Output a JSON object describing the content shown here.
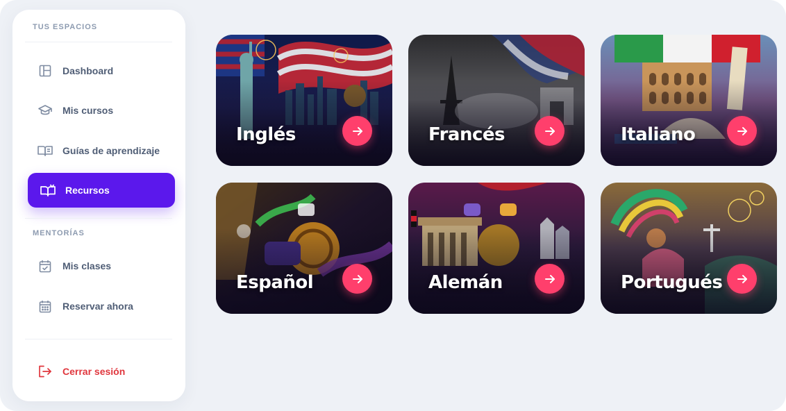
{
  "sidebar": {
    "section_spaces": "TUS ESPACIOS",
    "section_mentoring": "MENTORÍAS",
    "items": [
      {
        "label": "Dashboard",
        "icon": "layout-icon"
      },
      {
        "label": "Mis cursos",
        "icon": "graduation-cap-icon"
      },
      {
        "label": "Guías de aprendizaje",
        "icon": "open-book-icon"
      },
      {
        "label": "Recursos",
        "icon": "book-reader-icon",
        "active": true
      },
      {
        "label": "Mis clases",
        "icon": "calendar-check-icon"
      },
      {
        "label": "Reservar ahora",
        "icon": "calendar-grid-icon"
      }
    ],
    "logout_label": "Cerrar sesión",
    "logout_icon": "logout-icon"
  },
  "colors": {
    "accent": "#5b18ec",
    "arrow_button": "#ff3f6c",
    "logout": "#e0363d",
    "background": "#eef1f6"
  },
  "languages": [
    {
      "name": "Inglés",
      "icon": "arrow-right-icon"
    },
    {
      "name": "Francés",
      "icon": "arrow-right-icon"
    },
    {
      "name": "Italiano",
      "icon": "arrow-right-icon"
    },
    {
      "name": "Español",
      "icon": "arrow-right-icon"
    },
    {
      "name": "Alemán",
      "icon": "arrow-right-icon"
    },
    {
      "name": "Portugués",
      "icon": "arrow-right-icon"
    }
  ]
}
